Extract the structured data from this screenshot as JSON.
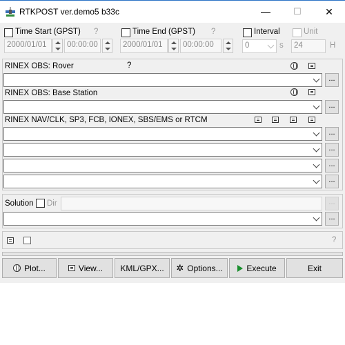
{
  "window": {
    "title": "RTKPOST ver.demo5 b33c",
    "controls": {
      "minimize": "—",
      "maximize": "☐",
      "close": "✕"
    }
  },
  "time": {
    "start_label": "Time Start (GPST)",
    "start_help": "?",
    "start_date": "2000/01/01",
    "start_time": "00:00:00",
    "end_label": "Time End (GPST)",
    "end_help": "?",
    "end_date": "2000/01/01",
    "end_time": "00:00:00",
    "interval_label": "Interval",
    "interval_value": "0",
    "interval_unit": "s",
    "unit_label": "Unit",
    "unit_value": "24",
    "unit_suffix": "H"
  },
  "inputs": {
    "rover_label": "RINEX OBS: Rover",
    "rover_help": "?",
    "base_label": "RINEX OBS: Base Station",
    "nav_label": "RINEX NAV/CLK, SP3, FCB, IONEX, SBS/EMS  or RTCM",
    "browse_label": "..."
  },
  "solution": {
    "label": "Solution",
    "dir_label": "Dir",
    "browse_label": "..."
  },
  "status": {
    "help": "?"
  },
  "buttons": {
    "plot": "Plot...",
    "view": "View...",
    "kml": "KML/GPX...",
    "options": "Options...",
    "execute": "Execute",
    "exit": "Exit"
  },
  "icons": {
    "app": "satellite-icon",
    "globe": "globe-icon",
    "document": "document-icon",
    "gear": "gear-icon",
    "play": "play-icon"
  },
  "colors": {
    "window_bg": "#f0f0f0",
    "title_bar": "#ffffff",
    "title_border": "#2b73c6",
    "execute_arrow": "#1a8f2e"
  }
}
